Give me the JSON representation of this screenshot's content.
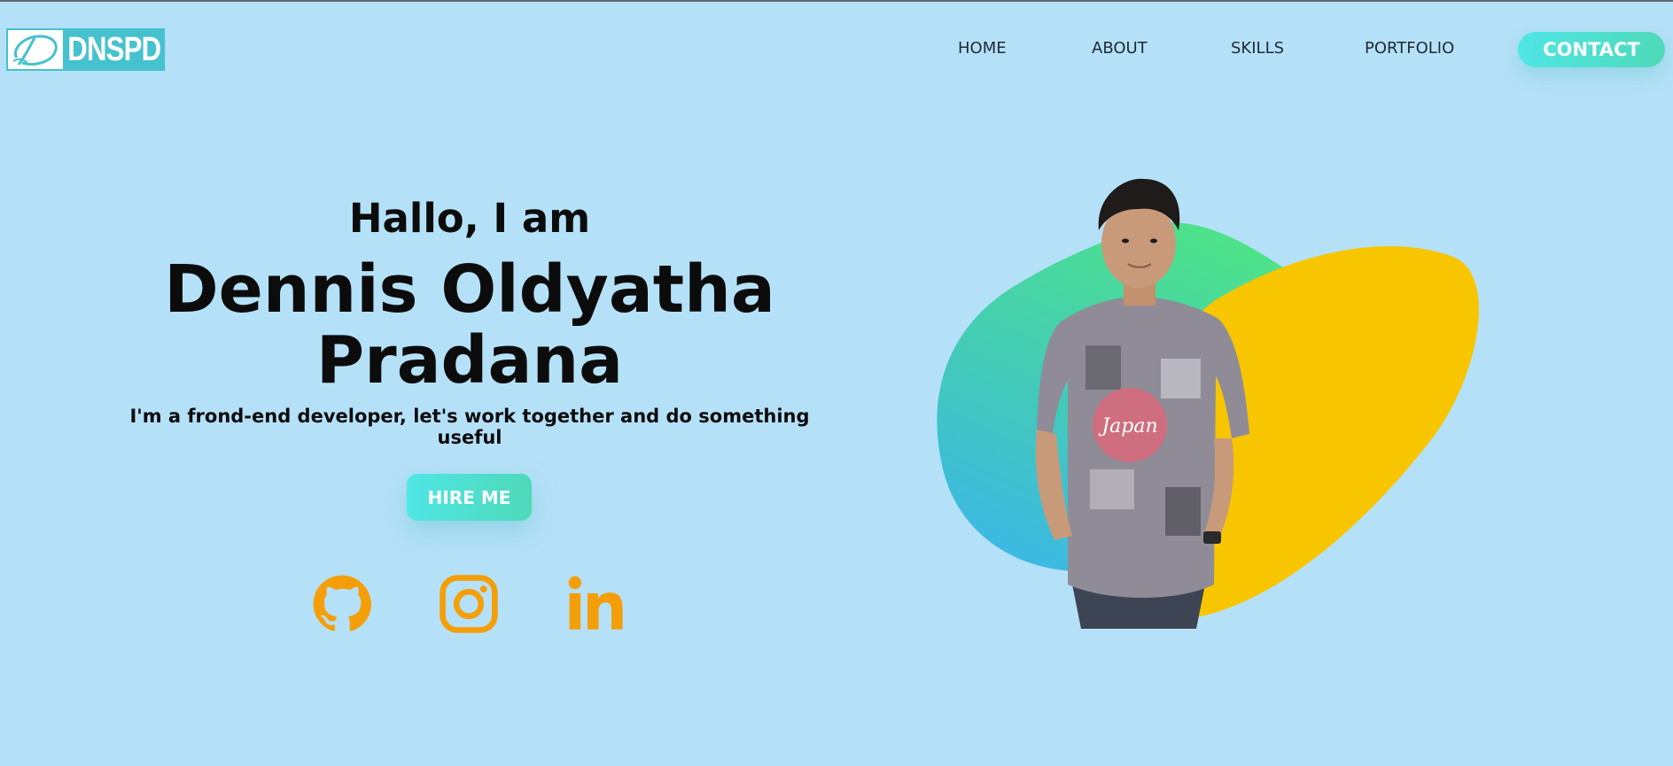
{
  "header": {
    "logo_text": "DNSPD",
    "nav": [
      {
        "label": "HOME"
      },
      {
        "label": "ABOUT"
      },
      {
        "label": "SKILLS"
      },
      {
        "label": "PORTFOLIO"
      }
    ],
    "contact_label": "CONTACT"
  },
  "hero": {
    "greeting": "Hallo, I am",
    "name_line1": "Dennis Oldyatha",
    "name_line2": "Pradana",
    "tagline": "I'm a frond-end developer, let's work together and do something useful",
    "hire_label": "HIRE ME",
    "social": [
      {
        "icon": "github-icon"
      },
      {
        "icon": "instagram-icon"
      },
      {
        "icon": "linkedin-icon"
      }
    ],
    "shirt_text": "Japan"
  },
  "colors": {
    "background": "#b5e1f8",
    "accent_gradient_start": "#4fe6e6",
    "accent_gradient_end": "#4ed9b8",
    "social_icon": "#f49f0a",
    "blob_yellow": "#f7c600",
    "blob_green": "#4ee388",
    "blob_blue": "#3cb8e6",
    "logo": "#46c2cf"
  }
}
